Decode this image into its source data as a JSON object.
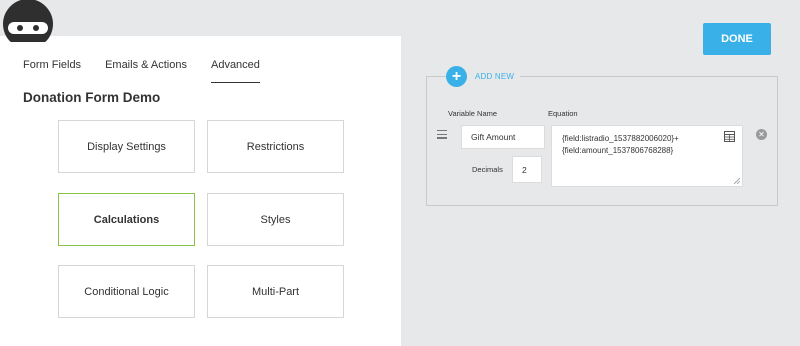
{
  "tabs": [
    {
      "label": "Form Fields"
    },
    {
      "label": "Emails & Actions"
    },
    {
      "label": "Advanced"
    }
  ],
  "active_tab": "Advanced",
  "form_title": "Donation Form Demo",
  "tiles": [
    {
      "label": "Display Settings"
    },
    {
      "label": "Restrictions"
    },
    {
      "label": "Calculations"
    },
    {
      "label": "Styles"
    },
    {
      "label": "Conditional Logic"
    },
    {
      "label": "Multi-Part"
    }
  ],
  "selected_tile": "Calculations",
  "done_label": "DONE",
  "add_new_label": "ADD NEW",
  "columns": {
    "variable_name": "Variable Name",
    "equation": "Equation"
  },
  "calculation": {
    "variable_name": "Gift Amount",
    "decimals_label": "Decimals",
    "decimals": "2",
    "equation_line1": "{field:listradio_1537882006020}+",
    "equation_line2": "{field:amount_1537806768288}"
  },
  "colors": {
    "accent": "#39b1e8",
    "selected_border": "#8bc34a",
    "background": "#e7e8ea"
  },
  "icons": [
    "ninja-logo",
    "plus-icon",
    "drag-handle-icon",
    "merge-tags-icon",
    "remove-icon"
  ]
}
